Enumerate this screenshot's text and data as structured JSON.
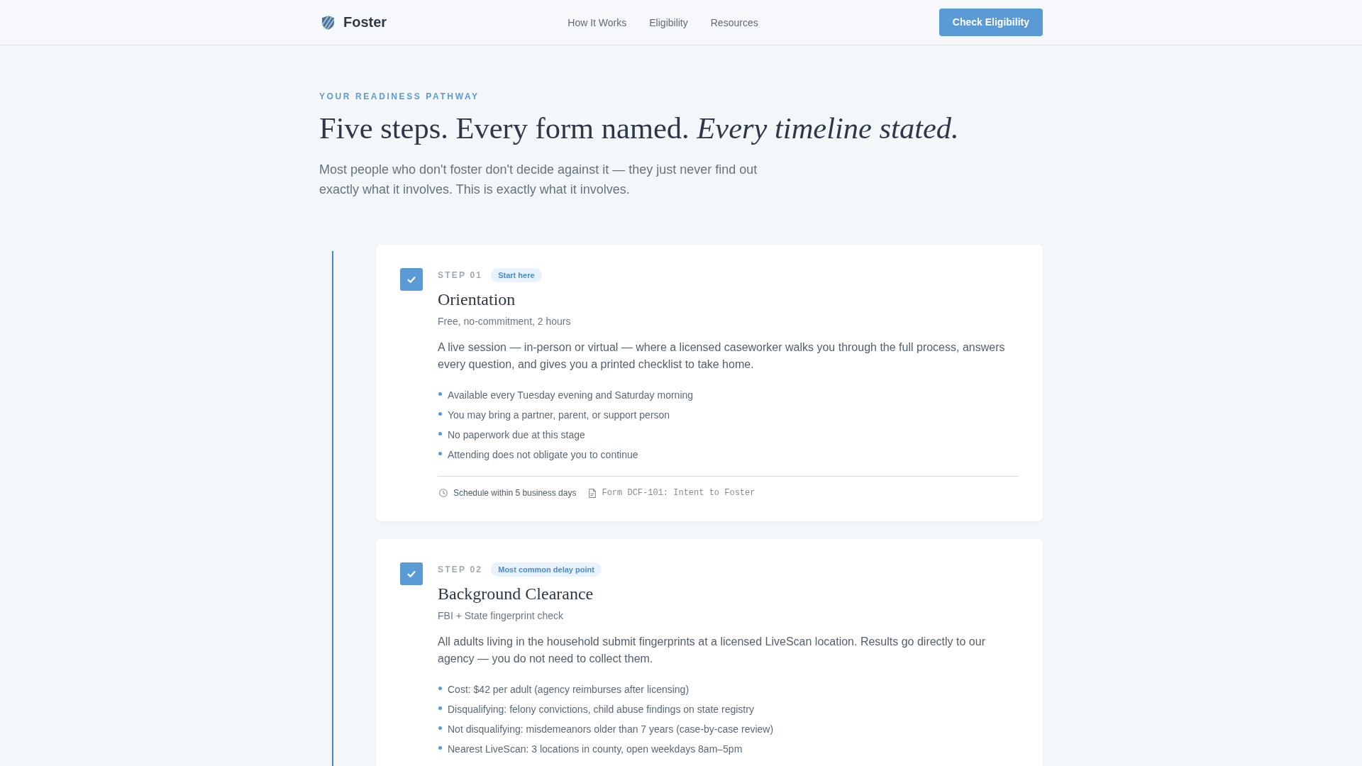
{
  "nav": {
    "brand": "Foster",
    "links": [
      "How It Works",
      "Eligibility",
      "Resources"
    ],
    "cta": "Check Eligibility"
  },
  "hero": {
    "eyebrow": "YOUR READINESS PATHWAY",
    "heading": "Five steps. Every form named. *Every timeline stated.*",
    "intro": "Most people who don't foster don't decide against it — they just never find out exactly what it involves. This is exactly what it involves."
  },
  "steps": [
    {
      "step": "STEP 01",
      "badge": "Start here",
      "checked": true,
      "title": "Orientation",
      "subtitle": "Free, no-commitment, 2 hours",
      "description": "A live session — in-person or virtual — where a licensed caseworker walks you through the full process, answers every question, and gives you a printed checklist to take home.",
      "bullets": [
        "Available every Tuesday evening and Saturday morning",
        "You may bring a partner, parent, or support person",
        "No paperwork due at this stage",
        "Attending does not obligate you to continue"
      ],
      "meta": [
        {
          "kind": "time",
          "text": "Schedule within 5 business days"
        },
        {
          "kind": "form",
          "text": "Form DCF-101: Intent to Foster"
        }
      ]
    },
    {
      "step": "STEP 02",
      "badge": "Most common delay point",
      "checked": true,
      "title": "Background Clearance",
      "subtitle": "FBI + State fingerprint check",
      "description": "All adults living in the household submit fingerprints at a licensed LiveScan location. Results go directly to our agency — you do not need to collect them.",
      "bullets": [
        "Cost: $42 per adult (agency reimburses after licensing)",
        "Disqualifying: felony convictions, child abuse findings on state registry",
        "Not disqualifying: misdemeanors older than 7 years (case-by-case review)",
        "Nearest LiveScan: 3 locations in county, open weekdays 8am–5pm"
      ]
    }
  ]
}
